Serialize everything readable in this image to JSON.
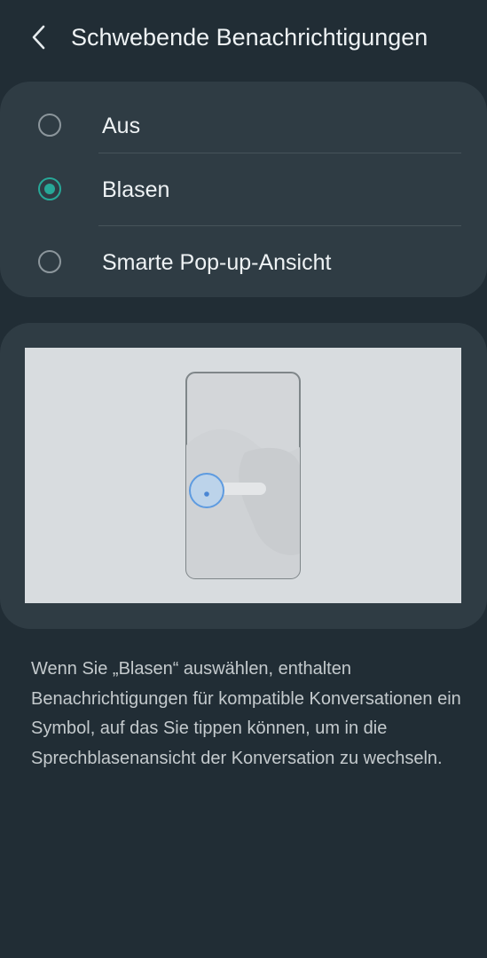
{
  "header": {
    "title": "Schwebende Benachrichtigungen",
    "back_icon": "chevron-left-icon"
  },
  "options": [
    {
      "label": "Aus",
      "selected": false
    },
    {
      "label": "Blasen",
      "selected": true
    },
    {
      "label": "Smarte Pop-up-Ansicht",
      "selected": false
    }
  ],
  "colors": {
    "background": "#212d35",
    "card": "#2f3c44",
    "accent": "#27a898"
  },
  "description": "Wenn Sie „Blasen“ auswählen, enthalten Benachrichtigungen für kompatible Konversationen ein Symbol, auf das Sie tippen können, um in die Sprechblasenansicht der Konversation zu wechseln."
}
